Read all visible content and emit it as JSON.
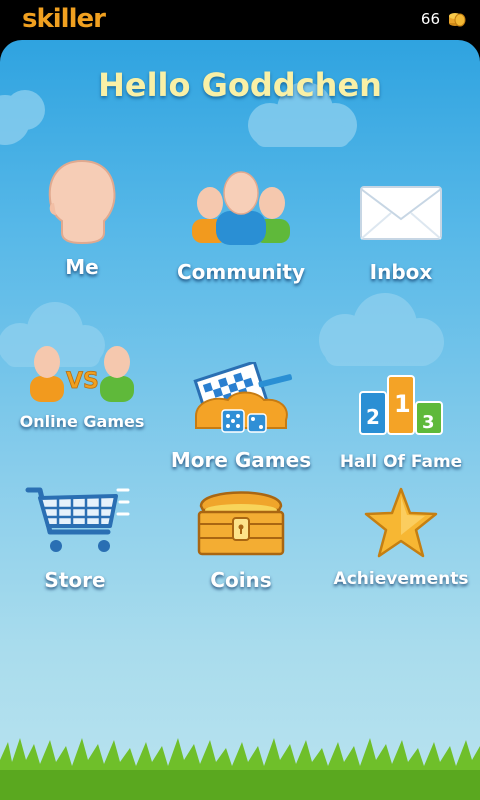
{
  "status_bar": {
    "app_name": "skiller",
    "coins": "66"
  },
  "header": {
    "title": "Hello Goddchen"
  },
  "menu": [
    {
      "label": "Me",
      "icon": "avatar-head-icon"
    },
    {
      "label": "Community",
      "icon": "community-people-icon"
    },
    {
      "label": "Inbox",
      "icon": "envelope-icon"
    },
    {
      "label": "Online Games",
      "icon": "versus-players-icon"
    },
    {
      "label": "More Games",
      "icon": "more-games-icon"
    },
    {
      "label": "Hall Of Fame",
      "icon": "podium-icon"
    },
    {
      "label": "Store",
      "icon": "shopping-cart-icon"
    },
    {
      "label": "Coins",
      "icon": "treasure-chest-icon"
    },
    {
      "label": "Achievements",
      "icon": "star-icon"
    }
  ],
  "colors": {
    "title": "#f9f0a6",
    "logo": "#f0a020",
    "sky_top": "#2fa3e0",
    "sky_bottom": "#b9e3ee",
    "grass": "#6fbf2a"
  }
}
